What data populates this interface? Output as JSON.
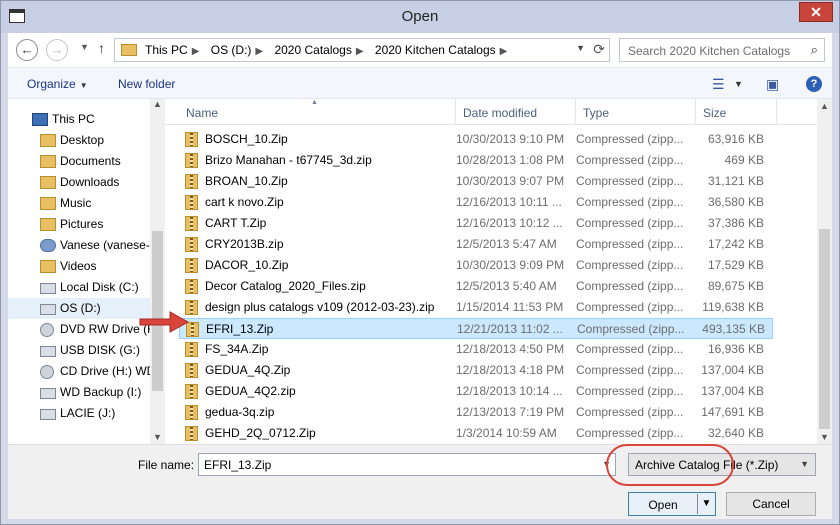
{
  "window": {
    "title": "Open",
    "close_glyph": "✕"
  },
  "nav": {
    "back_glyph": "←",
    "forward_glyph": "→",
    "up_glyph": "↑",
    "breadcrumbs": [
      "This PC",
      "OS (D:)",
      "2020 Catalogs",
      "2020 Kitchen Catalogs"
    ],
    "search_placeholder": "Search 2020 Kitchen Catalogs"
  },
  "toolbar": {
    "organize": "Organize",
    "new_folder": "New folder"
  },
  "sidebar": {
    "items": [
      {
        "label": "This PC",
        "icon": "pc-icon"
      },
      {
        "label": "Desktop",
        "icon": "folder-icon"
      },
      {
        "label": "Documents",
        "icon": "folder-icon"
      },
      {
        "label": "Downloads",
        "icon": "folder-icon"
      },
      {
        "label": "Music",
        "icon": "folder-icon"
      },
      {
        "label": "Pictures",
        "icon": "folder-icon"
      },
      {
        "label": "Vanese (vanese-p",
        "icon": "user-icon"
      },
      {
        "label": "Videos",
        "icon": "folder-icon"
      },
      {
        "label": "Local Disk (C:)",
        "icon": "drive-icon"
      },
      {
        "label": "OS (D:)",
        "icon": "drive-icon",
        "selected": true
      },
      {
        "label": "DVD RW Drive (F:",
        "icon": "disc-icon"
      },
      {
        "label": "USB DISK (G:)",
        "icon": "drive-icon"
      },
      {
        "label": "CD Drive (H:) WD",
        "icon": "disc-icon"
      },
      {
        "label": "WD Backup (I:)",
        "icon": "drive-icon"
      },
      {
        "label": "LACIE (J:)",
        "icon": "drive-icon"
      }
    ]
  },
  "columns": {
    "name": "Name",
    "date": "Date modified",
    "type": "Type",
    "size": "Size"
  },
  "files": [
    {
      "name": "BOSCH_10.Zip",
      "date": "10/30/2013 9:10 PM",
      "type": "Compressed (zipp...",
      "size": "63,916 KB"
    },
    {
      "name": "Brizo Manahan -  t67745_3d.zip",
      "date": "10/28/2013 1:08 PM",
      "type": "Compressed (zipp...",
      "size": "469 KB"
    },
    {
      "name": "BROAN_10.Zip",
      "date": "10/30/2013 9:07 PM",
      "type": "Compressed (zipp...",
      "size": "31,121 KB"
    },
    {
      "name": "cart k novo.Zip",
      "date": "12/16/2013 10:11 ...",
      "type": "Compressed (zipp...",
      "size": "36,580 KB"
    },
    {
      "name": "CART T.Zip",
      "date": "12/16/2013 10:12 ...",
      "type": "Compressed (zipp...",
      "size": "37,386 KB"
    },
    {
      "name": "CRY2013B.zip",
      "date": "12/5/2013 5:47 AM",
      "type": "Compressed (zipp...",
      "size": "17,242 KB"
    },
    {
      "name": "DACOR_10.Zip",
      "date": "10/30/2013 9:09 PM",
      "type": "Compressed (zipp...",
      "size": "17,529 KB"
    },
    {
      "name": "Decor Catalog_2020_Files.zip",
      "date": "12/5/2013 5:40 AM",
      "type": "Compressed (zipp...",
      "size": "89,675 KB"
    },
    {
      "name": "design plus catalogs  v109 (2012-03-23).zip",
      "date": "1/15/2014 11:53 PM",
      "type": "Compressed (zipp...",
      "size": "119,638 KB"
    },
    {
      "name": "EFRI_13.Zip",
      "date": "12/21/2013 11:02 ...",
      "type": "Compressed (zipp...",
      "size": "493,135 KB",
      "selected": true
    },
    {
      "name": "FS_34A.Zip",
      "date": "12/18/2013 4:50 PM",
      "type": "Compressed (zipp...",
      "size": "16,936 KB"
    },
    {
      "name": "GEDUA_4Q.Zip",
      "date": "12/18/2013 4:18 PM",
      "type": "Compressed (zipp...",
      "size": "137,004 KB"
    },
    {
      "name": "GEDUA_4Q2.zip",
      "date": "12/18/2013 10:14 ...",
      "type": "Compressed (zipp...",
      "size": "137,004 KB"
    },
    {
      "name": "gedua-3q.zip",
      "date": "12/13/2013 7:19 PM",
      "type": "Compressed (zipp...",
      "size": "147,691 KB"
    },
    {
      "name": "GEHD_2Q_0712.Zip",
      "date": "1/3/2014 10:59 AM",
      "type": "Compressed (zipp...",
      "size": "32,640 KB"
    }
  ],
  "footer": {
    "file_name_label": "File name:",
    "file_name_value": "EFRI_13.Zip",
    "filter": "Archive Catalog File (*.Zip)",
    "open": "Open",
    "cancel": "Cancel"
  },
  "colors": {
    "annotation_red": "#d9443b",
    "selection": "#cce8ff"
  }
}
